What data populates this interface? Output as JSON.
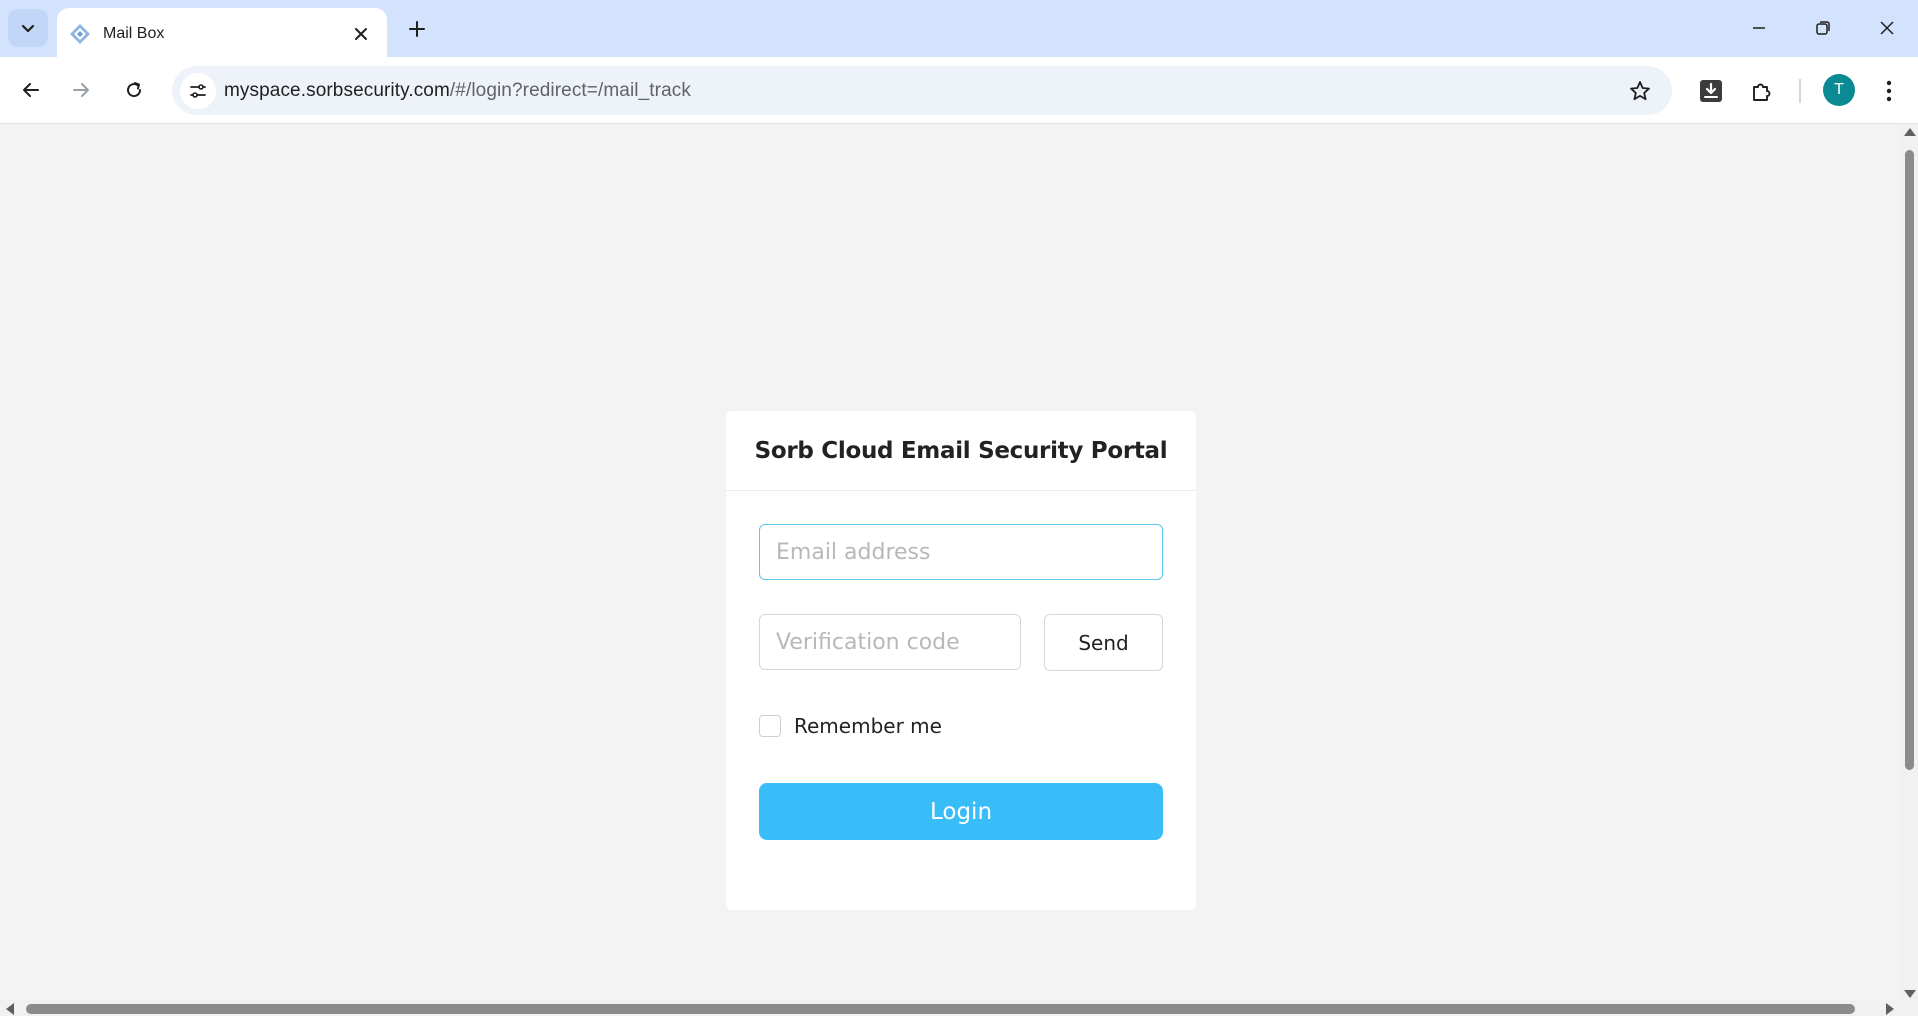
{
  "browser": {
    "tab": {
      "title": "Mail Box",
      "favicon": "mailbox-favicon-icon"
    },
    "url": {
      "host": "myspace.sorbsecurity.com",
      "path": "/#/login?redirect=/mail_track"
    },
    "profile_initial": "T",
    "icons": [
      "tab-search-icon",
      "close-icon",
      "new-tab-icon",
      "minimize-icon",
      "restore-icon",
      "window-close-icon",
      "back-icon",
      "forward-icon",
      "reload-icon",
      "site-settings-icon",
      "bookmark-star-icon",
      "download-icon",
      "extensions-icon",
      "more-menu-icon"
    ]
  },
  "login": {
    "title": "Sorb Cloud Email Security Portal",
    "email_placeholder": "Email address",
    "email_value": "",
    "code_placeholder": "Verification code",
    "code_value": "",
    "send_label": "Send",
    "remember_label": "Remember me",
    "remember_checked": false,
    "login_label": "Login"
  },
  "colors": {
    "accent": "#38bdf8",
    "input_focus_border": "#5ec6ea",
    "page_background": "#f3f3f3",
    "tabstrip": "#d3e3fd",
    "avatar": "#0b8a93"
  }
}
